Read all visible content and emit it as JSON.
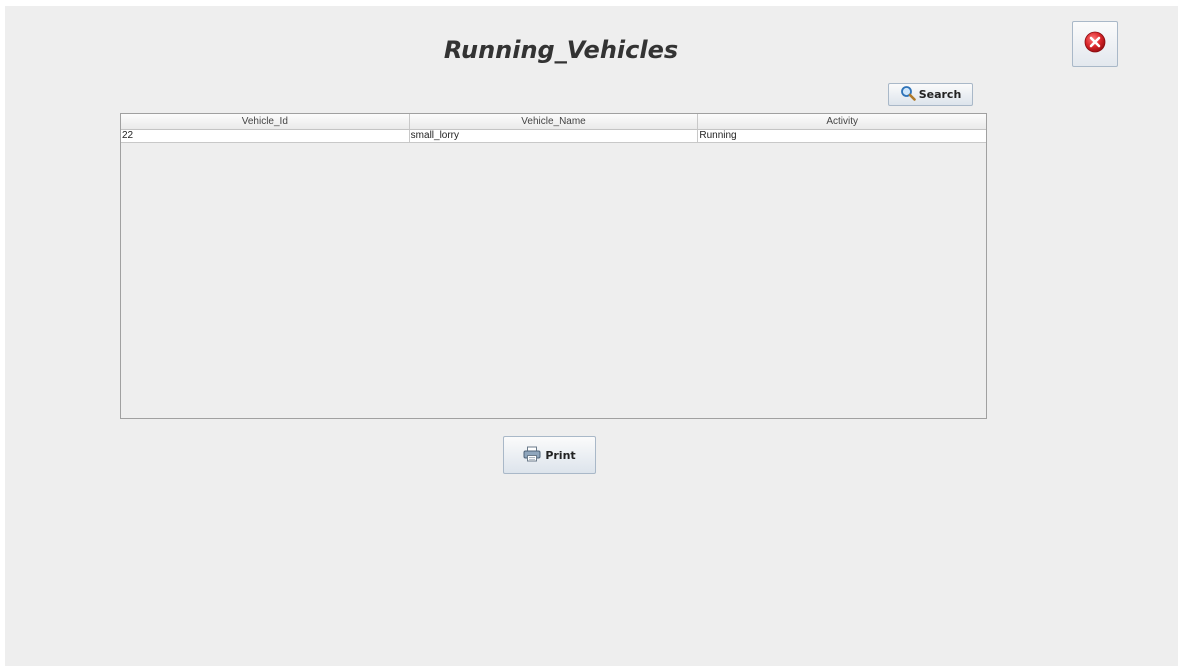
{
  "window": {
    "title": "Running_Vehicles"
  },
  "toolbar": {
    "close_icon": "close-circle-icon",
    "search_label": "Search",
    "search_icon": "magnifier-icon",
    "print_label": "Print",
    "print_icon": "printer-icon"
  },
  "table": {
    "columns": [
      "Vehicle_Id",
      "Vehicle_Name",
      "Activity"
    ],
    "rows": [
      [
        "22",
        "small_lorry",
        "Running"
      ]
    ]
  },
  "colors": {
    "background": "#eeeeee",
    "close_red": "#d9262a"
  }
}
